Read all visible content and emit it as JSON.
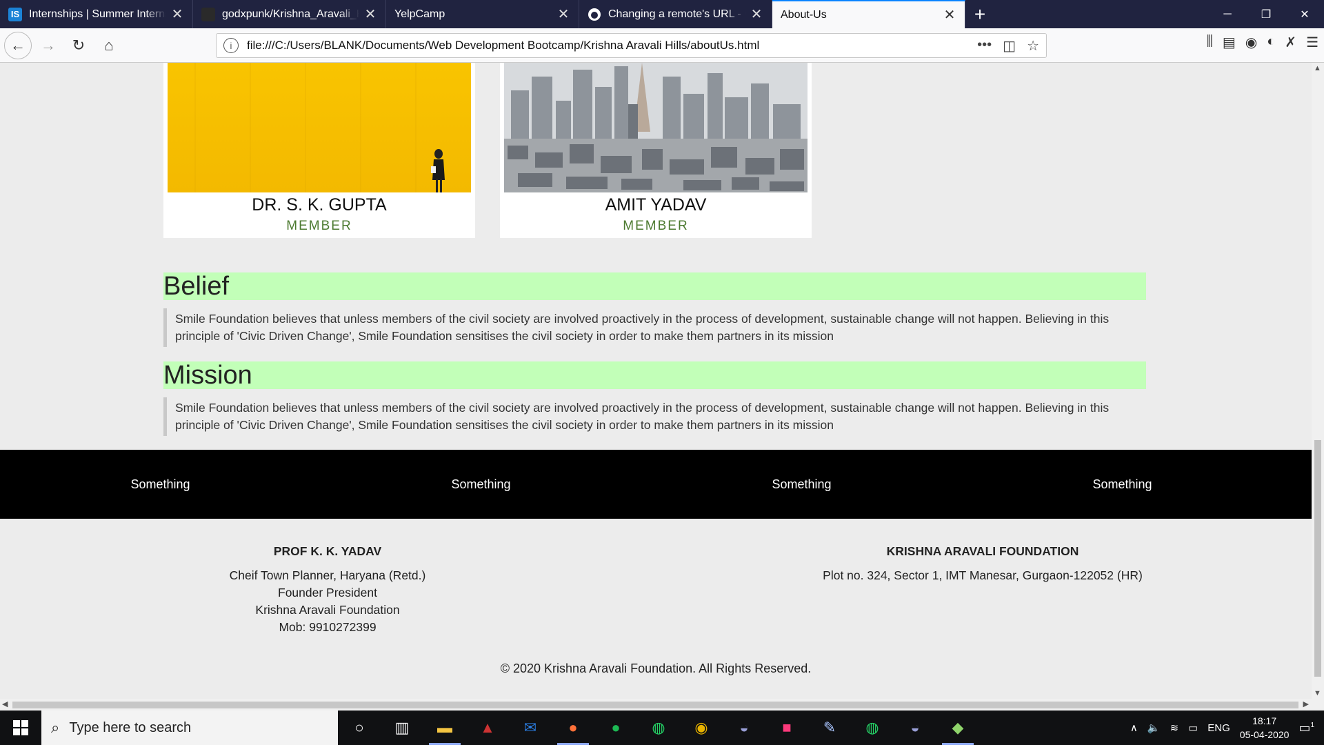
{
  "browser": {
    "tabs": [
      {
        "title": "Internships | Summer Internships",
        "favicon": "IS"
      },
      {
        "title": "godxpunk/Krishna_Aravali_Hills",
        "favicon": ""
      },
      {
        "title": "YelpCamp",
        "favicon": ""
      },
      {
        "title": "Changing a remote's URL - GitHub",
        "favicon": ""
      },
      {
        "title": "About-Us",
        "favicon": ""
      }
    ],
    "url": "file:///C:/Users/BLANK/Documents/Web Development Bootcamp/Krishna Aravali Hills/aboutUs.html"
  },
  "members": [
    {
      "name": "DR. S. K. GUPTA",
      "role": "MEMBER"
    },
    {
      "name": "AMIT YADAV",
      "role": "MEMBER"
    }
  ],
  "sections": [
    {
      "heading": "Belief",
      "text": "Smile Foundation believes that unless members of the civil society are involved proactively in the process of development, sustainable change will not happen. Believing in this principle of 'Civic Driven Change', Smile Foundation sensitises the civil society in order to make them partners in its mission"
    },
    {
      "heading": "Mission",
      "text": "Smile Foundation believes that unless members of the civil society are involved proactively in the process of development, sustainable change will not happen. Believing in this principle of 'Civic Driven Change', Smile Foundation sensitises the civil society in order to make them partners in its mission"
    }
  ],
  "footer_links": [
    "Something",
    "Something",
    "Something",
    "Something"
  ],
  "contact_left": {
    "heading": "PROF K. K. YADAV",
    "line1": "Cheif Town Planner, Haryana (Retd.)",
    "line2": "Founder President",
    "line3": "Krishna Aravali Foundation",
    "line4": "Mob: 9910272399"
  },
  "contact_right": {
    "heading": "KRISHNA ARAVALI FOUNDATION",
    "line1": "Plot no. 324, Sector 1, IMT Manesar, Gurgaon-122052 (HR)"
  },
  "copyright": "© 2020 Krishna Aravali Foundation. All Rights Reserved.",
  "taskbar": {
    "search_placeholder": "Type here to search",
    "lang": "ENG",
    "time": "18:17",
    "date": "05-04-2020",
    "notifications": "1"
  },
  "colors": {
    "section_bg": "#c2ffb8",
    "role": "#4c7a30",
    "tab_bar": "#202340"
  }
}
